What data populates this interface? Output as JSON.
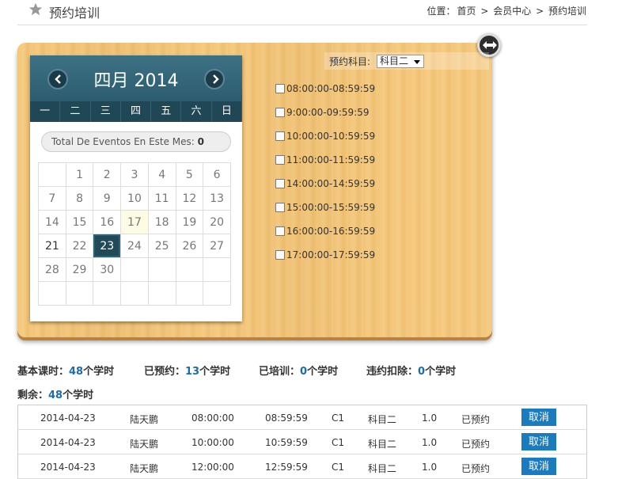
{
  "header": {
    "title": "预约培训",
    "breadcrumb": {
      "prefix": "位置：",
      "items": [
        "首页",
        "会员中心",
        "预约培训"
      ],
      "separator": ">"
    }
  },
  "calendar": {
    "month_label": "四月 2014",
    "weekdays": [
      "一",
      "二",
      "三",
      "四",
      "五",
      "六",
      "日"
    ],
    "events_label": "Total De Eventos En Este Mes:",
    "events_count": "0",
    "weeks": [
      [
        "",
        "1",
        "2",
        "3",
        "4",
        "5",
        "6"
      ],
      [
        "7",
        "8",
        "9",
        "10",
        "11",
        "12",
        "13"
      ],
      [
        "14",
        "15",
        "16",
        "17",
        "18",
        "19",
        "20"
      ],
      [
        "21",
        "22",
        "23",
        "24",
        "25",
        "26",
        "27"
      ],
      [
        "28",
        "29",
        "30",
        "",
        "",
        "",
        ""
      ],
      [
        "",
        "",
        "",
        "",
        "",
        "",
        ""
      ]
    ],
    "today": "17",
    "selected": "23"
  },
  "booking": {
    "subject_label": "预约科目:",
    "subject_value": "科目二",
    "slots": [
      "08:00:00-08:59:59",
      "9:00:00-09:59:59",
      "10:00:00-10:59:59",
      "11:00:00-11:59:59",
      "14:00:00-14:59:59",
      "15:00:00-15:59:59",
      "16:00:00-16:59:59",
      "17:00:00-17:59:59"
    ]
  },
  "stats": {
    "basic_label": "基本课时：",
    "basic_value": "48",
    "basic_unit": "个学时",
    "booked_label": "已预约：",
    "booked_value": "13",
    "booked_unit": "个学时",
    "trained_label": "已培训：",
    "trained_value": "0",
    "trained_unit": "个学时",
    "penalty_label": "违约扣除：",
    "penalty_value": "0",
    "penalty_unit": "个学时",
    "remain_label": "剩余：",
    "remain_value": "48",
    "remain_unit": "个学时"
  },
  "records": [
    {
      "date": "2014-04-23",
      "name": "陆天鹏",
      "start": "08:00:00",
      "end": "08:59:59",
      "type": "C1",
      "subject": "科目二",
      "hours": "1.0",
      "status": "已预约",
      "action": "取消"
    },
    {
      "date": "2014-04-23",
      "name": "陆天鹏",
      "start": "10:00:00",
      "end": "10:59:59",
      "type": "C1",
      "subject": "科目二",
      "hours": "1.0",
      "status": "已预约",
      "action": "取消"
    },
    {
      "date": "2014-04-23",
      "name": "陆天鹏",
      "start": "12:00:00",
      "end": "12:59:59",
      "type": "C1",
      "subject": "科目二",
      "hours": "1.0",
      "status": "已预约",
      "action": "取消"
    }
  ]
}
